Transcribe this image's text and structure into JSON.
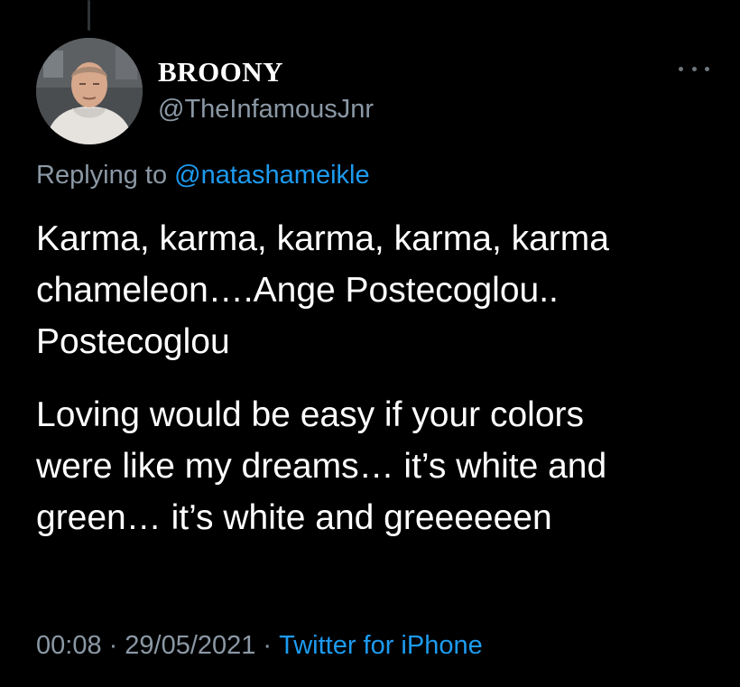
{
  "author": {
    "display_name": "BROONY",
    "handle": "@TheInfamousJnr",
    "avatar_icon": "profile-photo"
  },
  "more_icon": "more-horizontal-icon",
  "reply_context": {
    "prefix": "Replying to",
    "mention": "@natashameikle"
  },
  "tweet": {
    "paragraph_1": [
      "Karma, karma, karma, karma, karma",
      "chameleon….Ange Postecoglou..",
      "Postecoglou"
    ],
    "paragraph_2": [
      "Loving would be easy if your colors",
      "were like my dreams… it’s white and",
      "green… it’s white and greeeeeen"
    ]
  },
  "meta": {
    "time": "00:08",
    "separator": "·",
    "date": "29/05/2021",
    "source": "Twitter for iPhone"
  },
  "colors": {
    "background": "#000000",
    "text": "#ffffff",
    "secondary_text": "#8b98a5",
    "link": "#1d9bf0"
  }
}
